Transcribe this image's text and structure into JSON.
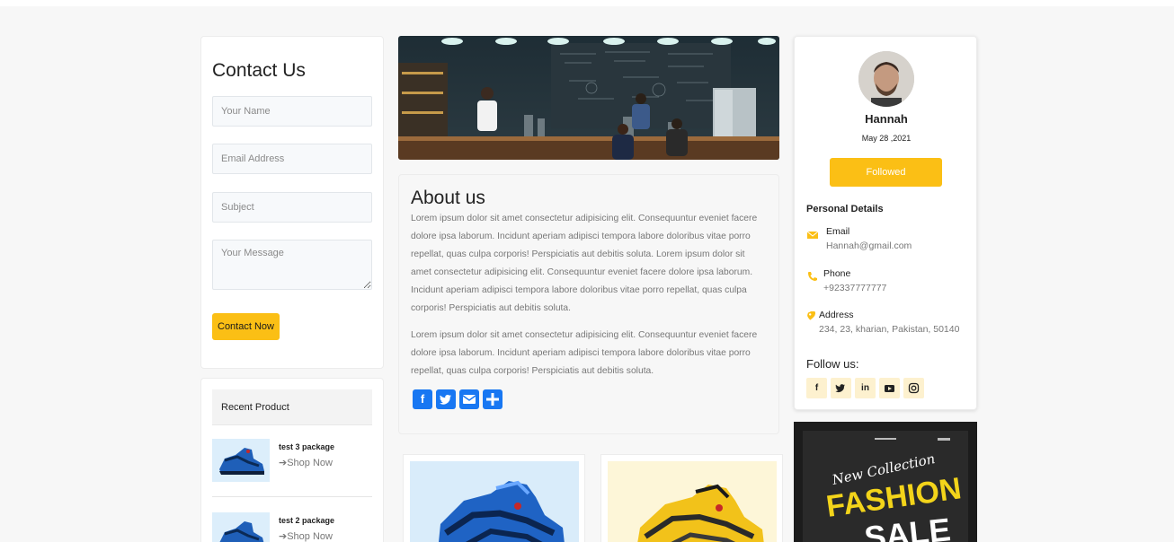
{
  "contact": {
    "title": "Contact Us",
    "name_placeholder": "Your Name",
    "email_placeholder": "Email Address",
    "subject_placeholder": "Subject",
    "message_placeholder": "Your Message",
    "submit_label": "Contact Now"
  },
  "recent": {
    "title": "Recent Product",
    "items": [
      {
        "name": "test 3 package",
        "link": "Shop Now"
      },
      {
        "name": "test 2 package",
        "link": "Shop Now"
      }
    ]
  },
  "about": {
    "title": "About us",
    "paragraph1": "Lorem ipsum dolor sit amet consectetur adipisicing elit. Consequuntur eveniet facere dolore ipsa laborum. Incidunt aperiam adipisci tempora labore doloribus vitae porro repellat, quas culpa corporis! Perspiciatis aut debitis soluta. Lorem ipsum dolor sit amet consectetur adipisicing elit. Consequuntur eveniet facere dolore ipsa laborum. Incidunt aperiam adipisci tempora labore doloribus vitae porro repellat, quas culpa corporis! Perspiciatis aut debitis soluta.",
    "paragraph2": "Lorem ipsum dolor sit amet consectetur adipisicing elit. Consequuntur eveniet facere dolore ipsa laborum. Incidunt aperiam adipisci tempora labore doloribus vitae porro repellat, quas culpa corporis! Perspiciatis aut debitis soluta.",
    "share_icons": [
      "facebook-icon",
      "twitter-icon",
      "email-icon",
      "share-icon"
    ]
  },
  "profile": {
    "name": "Hannah",
    "date": "May 28 ,2021",
    "follow_button": "Followed",
    "personal_title": "Personal Details",
    "email_label": "Email",
    "email_value": "Hannah@gmail.com",
    "phone_label": "Phone",
    "phone_value": "+92337777777",
    "address_label": "Address",
    "address_value": "234, 23, kharian, Pakistan, 50140",
    "follow_title": "Follow us:",
    "social": [
      "facebook-icon",
      "twitter-icon",
      "linkedin-icon",
      "youtube-icon",
      "instagram-icon"
    ]
  },
  "ad": {
    "line1": "New Collection",
    "line2": "FASHION",
    "line3": "SALE"
  },
  "colors": {
    "accent": "#fbbf15",
    "share_blue": "#1877f2",
    "background": "#f7f7f7"
  }
}
